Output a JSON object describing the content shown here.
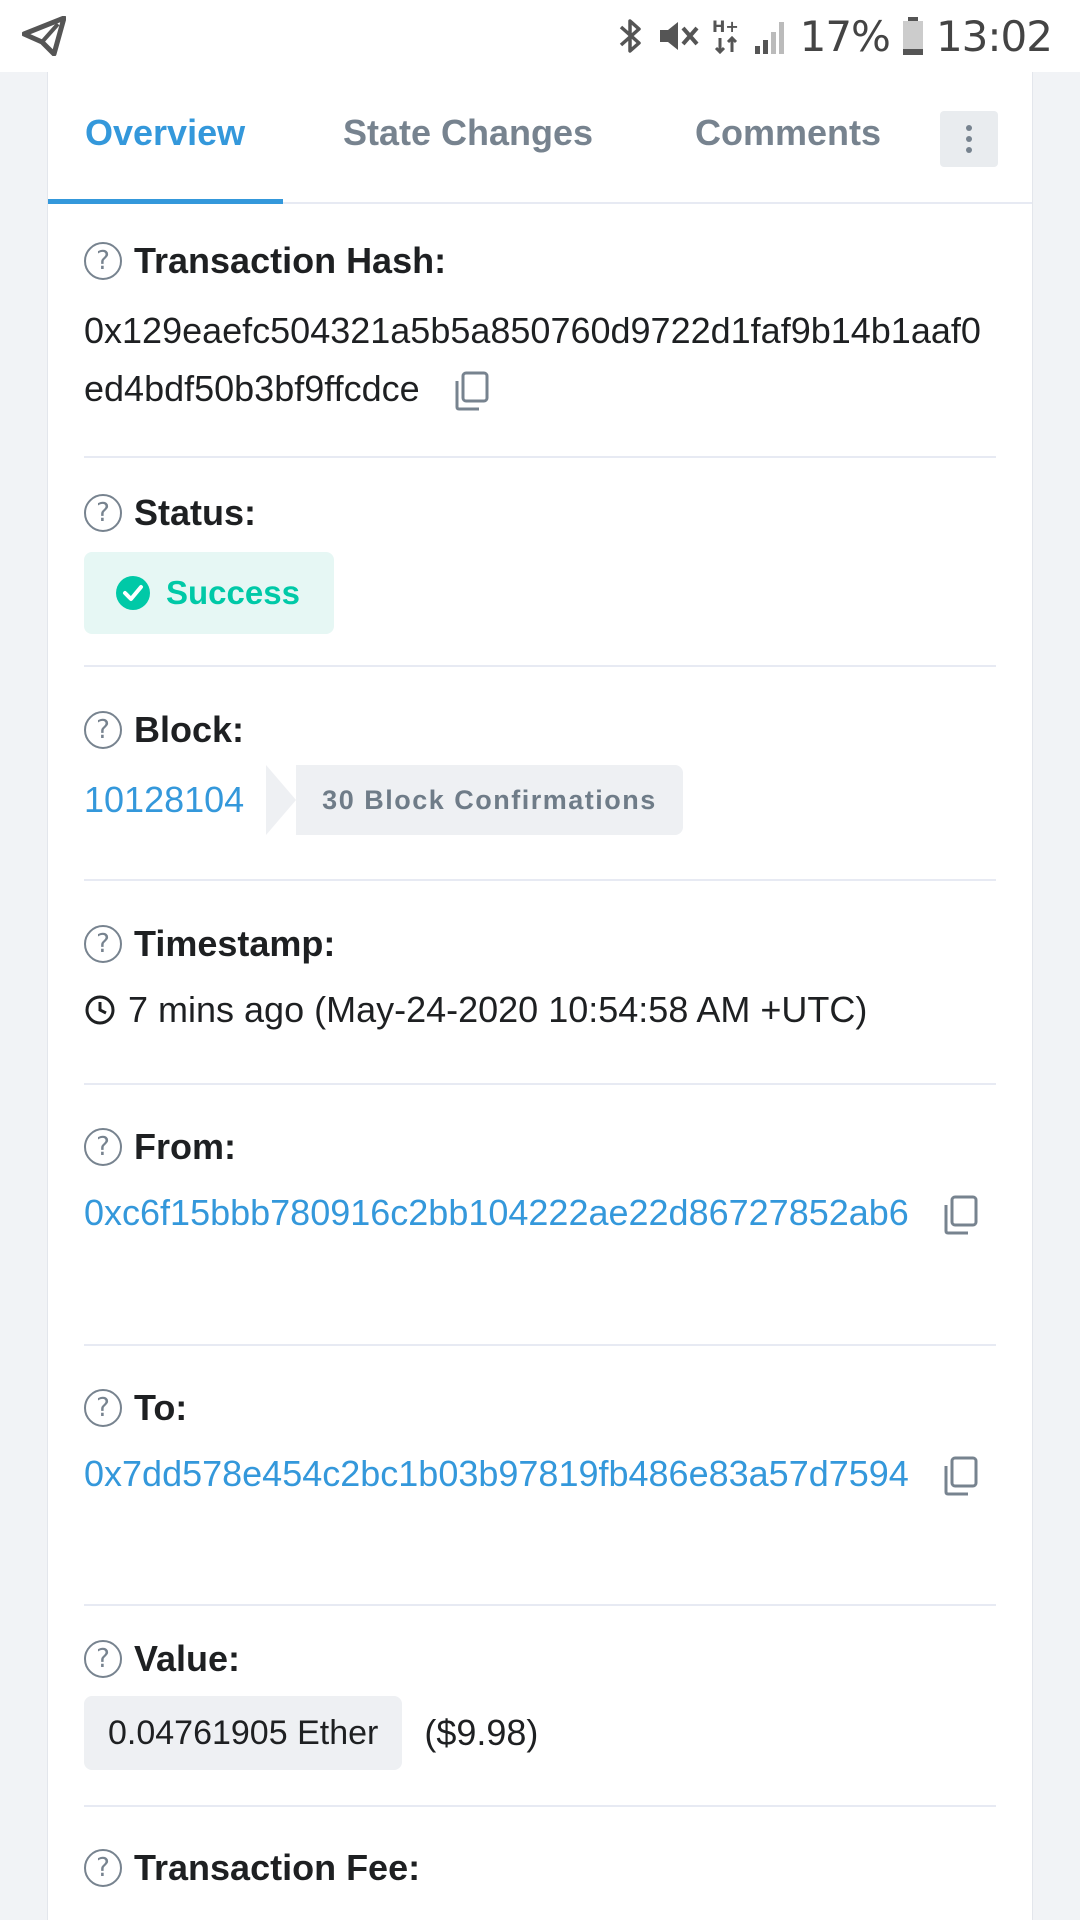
{
  "status_bar": {
    "battery_percent": "17%",
    "time": "13:02",
    "icons": [
      "telegram-send-icon",
      "bluetooth-icon",
      "mute-icon",
      "hplus-network-icon",
      "signal-icon",
      "battery-icon"
    ]
  },
  "tabs": [
    {
      "label": "Overview",
      "active": true
    },
    {
      "label": "State Changes",
      "active": false
    },
    {
      "label": "Comments",
      "active": false
    }
  ],
  "transaction": {
    "hash_label": "Transaction Hash:",
    "hash": "0x129eaefc504321a5b5a850760d9722d1faf9b14b1aaf0ed4bdf50b3bf9ffcdce",
    "status_label": "Status:",
    "status": "Success",
    "block_label": "Block:",
    "block": "10128104",
    "confirmations": "30 Block Confirmations",
    "timestamp_label": "Timestamp:",
    "timestamp": "7 mins ago (May-24-2020 10:54:58 AM +UTC)",
    "from_label": "From:",
    "from": "0xc6f15bbb780916c2bb104222ae22d86727852ab6",
    "to_label": "To:",
    "to": "0x7dd578e454c2bc1b03b97819fb486e83a57d7594",
    "value_label": "Value:",
    "value": "0.04761905 Ether",
    "value_usd": "($9.98)",
    "fee_label": "Transaction Fee:"
  },
  "colors": {
    "accent": "#3498db",
    "success": "#00c9a7",
    "success_bg": "#e6f7f4",
    "muted": "#77838f"
  }
}
